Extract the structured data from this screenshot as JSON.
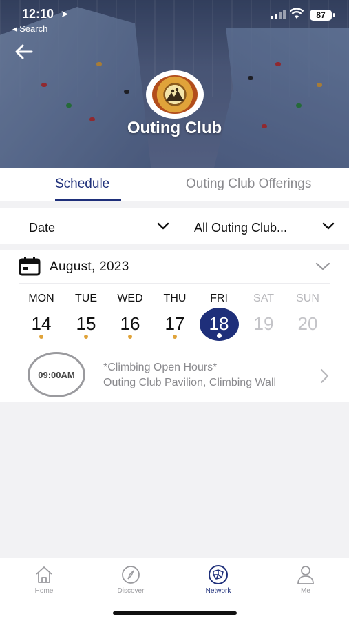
{
  "status_bar": {
    "time": "12:10",
    "back_label": "◂ Search",
    "battery": "87"
  },
  "header": {
    "title": "Outing Club",
    "back_icon": "back-arrow-icon",
    "logo_icon": "outing-club-logo"
  },
  "tabs": [
    {
      "label": "Schedule",
      "selected": true
    },
    {
      "label": "Outing Club Offerings",
      "selected": false
    }
  ],
  "filters": {
    "date_label": "Date",
    "category_label": "All Outing Club..."
  },
  "calendar": {
    "month_label": "August,  2023",
    "days": [
      {
        "dow": "MON",
        "num": "14",
        "has_event": true,
        "selected": false,
        "disabled": false
      },
      {
        "dow": "TUE",
        "num": "15",
        "has_event": true,
        "selected": false,
        "disabled": false
      },
      {
        "dow": "WED",
        "num": "16",
        "has_event": true,
        "selected": false,
        "disabled": false
      },
      {
        "dow": "THU",
        "num": "17",
        "has_event": true,
        "selected": false,
        "disabled": false
      },
      {
        "dow": "FRI",
        "num": "18",
        "has_event": true,
        "selected": true,
        "disabled": false
      },
      {
        "dow": "SAT",
        "num": "19",
        "has_event": false,
        "selected": false,
        "disabled": true
      },
      {
        "dow": "SUN",
        "num": "20",
        "has_event": false,
        "selected": false,
        "disabled": true
      }
    ]
  },
  "events": [
    {
      "time": "09:00AM",
      "title": "*Climbing Open Hours*",
      "location": "Outing Club Pavilion, Climbing Wall"
    }
  ],
  "bottom_nav": [
    {
      "label": "Home",
      "icon": "home-icon",
      "active": false
    },
    {
      "label": "Discover",
      "icon": "compass-icon",
      "active": false
    },
    {
      "label": "Network",
      "icon": "network-icon",
      "active": true
    },
    {
      "label": "Me",
      "icon": "person-icon",
      "active": false
    }
  ],
  "colors": {
    "accent": "#1e2f7a",
    "event_dot": "#e0a33a"
  }
}
